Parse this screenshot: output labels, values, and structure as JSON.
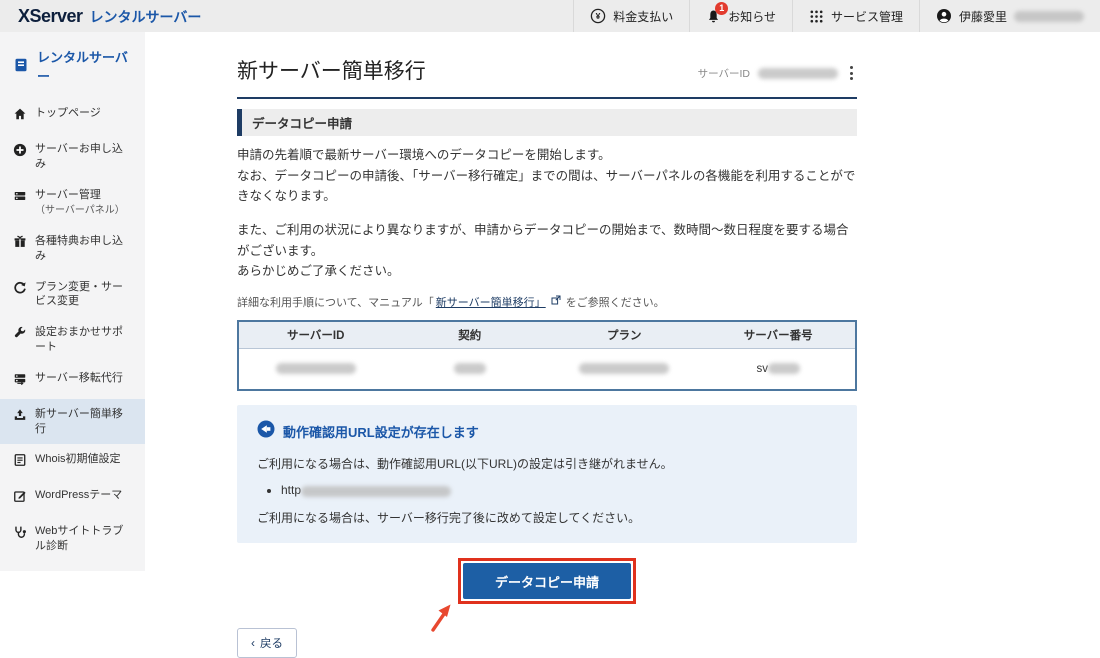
{
  "colors": {
    "brand_blue": "#1b57a8",
    "navy": "#1e3c64",
    "button_blue": "#1d5fa5",
    "highlight_red": "#e0311d",
    "notice_bg": "#eaf1f9",
    "badge_red": "#e23b2e",
    "sidebar_active_bg": "#dbe5f0"
  },
  "header": {
    "logo_primary": "XServer",
    "logo_secondary": "レンタルサーバー",
    "nav": [
      {
        "icon": "yen-circle-icon",
        "label": "料金支払い"
      },
      {
        "icon": "bell-icon",
        "label": "お知らせ",
        "badge": "1"
      },
      {
        "icon": "grid-icon",
        "label": "サービス管理"
      },
      {
        "icon": "user-icon",
        "label": "伊藤愛里"
      }
    ]
  },
  "sidebar": {
    "title": "レンタルサーバー",
    "items": [
      {
        "icon": "home-icon",
        "label": "トップページ"
      },
      {
        "icon": "plus-circle-icon",
        "label": "サーバーお申し込み"
      },
      {
        "icon": "server-icon",
        "label": "サーバー管理",
        "sublabel": "（サーバーパネル）"
      },
      {
        "icon": "gift-icon",
        "label": "各種特典お申し込み"
      },
      {
        "icon": "refresh-icon",
        "label": "プラン変更・サービス変更"
      },
      {
        "icon": "wrench-icon",
        "label": "設定おまかせサポート"
      },
      {
        "icon": "server-move-icon",
        "label": "サーバー移転代行"
      },
      {
        "icon": "upload-icon",
        "label": "新サーバー簡単移行",
        "active": true
      },
      {
        "icon": "document-icon",
        "label": "Whois初期値設定"
      },
      {
        "icon": "compose-icon",
        "label": "WordPressテーマ"
      },
      {
        "icon": "stethoscope-icon",
        "label": "Webサイトトラブル診断"
      }
    ]
  },
  "main": {
    "page_title": "新サーバー簡単移行",
    "server_id_label": "サーバーID",
    "section_title": "データコピー申請",
    "paragraph1_line1": "申請の先着順で最新サーバー環境へのデータコピーを開始します。",
    "paragraph1_line2": "なお、データコピーの申請後、「サーバー移行確定」までの間は、サーバーパネルの各機能を利用することができなくなります。",
    "paragraph2_line1": "また、ご利用の状況により異なりますが、申請からデータコピーの開始まで、数時間〜数日程度を要する場合がございます。",
    "paragraph2_line2": "あらかじめご了承ください。",
    "manual_note_prefix": "詳細な利用手順について、マニュアル「",
    "manual_link_text": "新サーバー簡単移行」",
    "manual_note_suffix": "をご参照ください。",
    "table": {
      "headers": [
        "サーバーID",
        "契約",
        "プラン",
        "サーバー番号"
      ],
      "row": {
        "server_number_prefix": "sv"
      }
    },
    "notice": {
      "icon": "megaphone-icon",
      "title": "動作確認用URL設定が存在します",
      "line1": "ご利用になる場合は、動作確認用URL(以下URL)の設定は引き継がれません。",
      "bullet_url_prefix": "http",
      "line2": "ご利用になる場合は、サーバー移行完了後に改めて設定してください。"
    },
    "submit_button_label": "データコピー申請",
    "back_button_chevron": "‹",
    "back_button_label": "戻る"
  }
}
